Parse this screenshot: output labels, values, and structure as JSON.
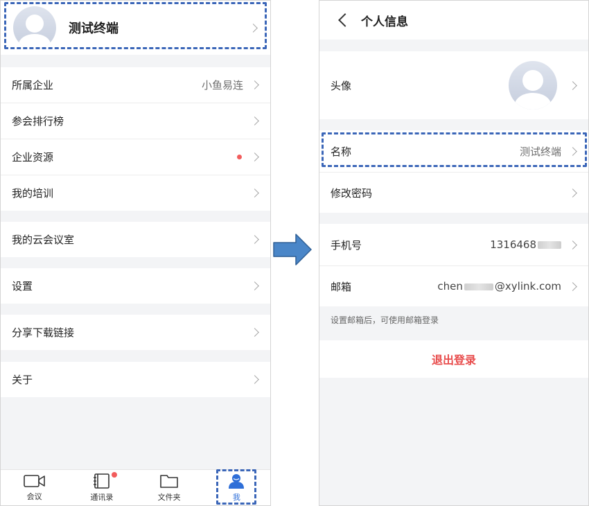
{
  "left": {
    "profile": {
      "name": "测试终端"
    },
    "menu": [
      {
        "label": "所属企业",
        "value": "小鱼易连"
      },
      {
        "label": "参会排行榜"
      },
      {
        "label": "企业资源"
      },
      {
        "label": "我的培训"
      },
      {
        "label": "我的云会议室"
      },
      {
        "label": "设置"
      },
      {
        "label": "分享下载链接"
      },
      {
        "label": "关于"
      }
    ],
    "tabs": [
      {
        "label": "会议",
        "icon": "video-camera-icon"
      },
      {
        "label": "通讯录",
        "icon": "contacts-book-icon"
      },
      {
        "label": "文件夹",
        "icon": "folder-icon"
      },
      {
        "label": "我",
        "icon": "person-icon"
      }
    ]
  },
  "right": {
    "header": {
      "title": "个人信息"
    },
    "avatar_label": "头像",
    "name_row": {
      "label": "名称",
      "value": "测试终端"
    },
    "password_label": "修改密码",
    "phone": {
      "label": "手机号",
      "value_visible": "1316468"
    },
    "email": {
      "label": "邮箱",
      "prefix": "chen",
      "suffix": "@xylink.com"
    },
    "hint": "设置邮箱后，可使用邮箱登录",
    "logout": "退出登录"
  },
  "colors": {
    "accent": "#2f6fd8",
    "danger": "#e84c4c",
    "highlight_dash": "#3b66b8",
    "arrow": "#4a86c8"
  }
}
